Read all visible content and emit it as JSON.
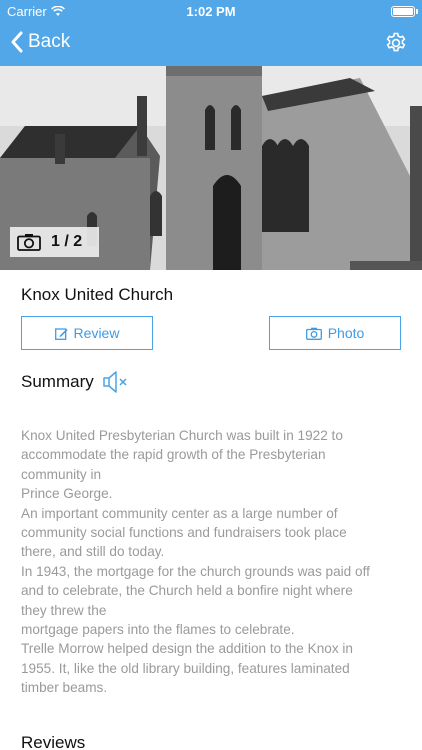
{
  "status_bar": {
    "carrier": "Carrier",
    "time": "1:02 PM",
    "battery_level": 1.0
  },
  "nav": {
    "back_label": "Back",
    "settings_icon": "gear-icon",
    "accent": "#52a7e8"
  },
  "photo": {
    "counter": "1 / 2",
    "camera_icon": "camera-icon"
  },
  "place": {
    "title": "Knox United Church"
  },
  "actions": {
    "review_label": "Review",
    "photo_label": "Photo"
  },
  "summary": {
    "heading": "Summary",
    "lines": [
      "Knox United Presbyterian Church was built in 1922 to",
      "accommodate the rapid growth of the Presbyterian",
      "community in",
      "Prince George.",
      "An important community center as a large number of",
      "community social functions and fundraisers took place",
      "there, and still do today.",
      "In 1943, the mortgage for the church grounds was paid off",
      "and to celebrate, the Church held a bonfire night where",
      "they threw the",
      "mortgage papers into the flames to celebrate.",
      "Trelle Morrow helped design the addition to the Knox in",
      "1955. It, like the old library building, features laminated",
      "timber beams."
    ]
  },
  "reviews": {
    "heading": "Reviews"
  }
}
